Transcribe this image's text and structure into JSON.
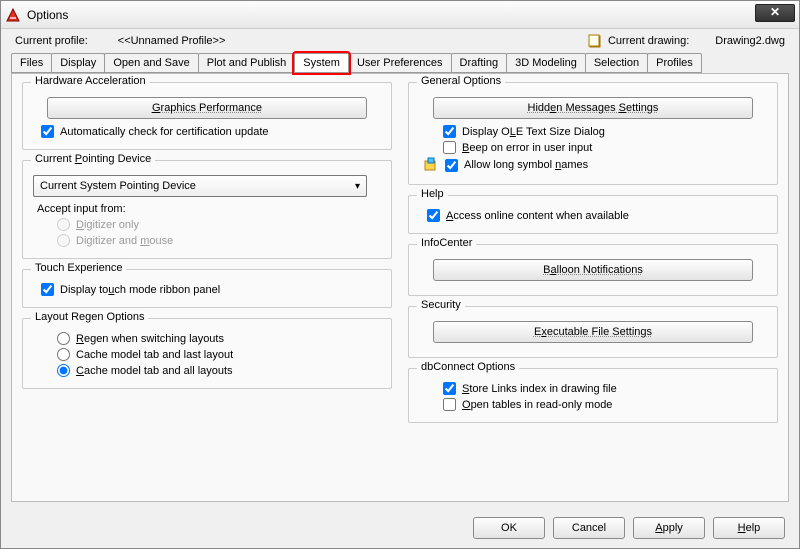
{
  "window": {
    "title": "Options"
  },
  "profile": {
    "label": "Current profile:",
    "value": "<<Unnamed Profile>>",
    "drawing_label": "Current drawing:",
    "drawing_value": "Drawing2.dwg"
  },
  "tabs": [
    {
      "label": "Files"
    },
    {
      "label": "Display"
    },
    {
      "label": "Open and Save"
    },
    {
      "label": "Plot and Publish"
    },
    {
      "label": "System",
      "active": true
    },
    {
      "label": "User Preferences"
    },
    {
      "label": "Drafting"
    },
    {
      "label": "3D Modeling"
    },
    {
      "label": "Selection"
    },
    {
      "label": "Profiles"
    }
  ],
  "left": {
    "hw_accel": {
      "title": "Hardware Acceleration",
      "button": "Graphics Performance",
      "auto_check": "Automatically check for certification update",
      "auto_check_val": true
    },
    "pointing": {
      "title": "Current Pointing Device",
      "combo": "Current System Pointing Device",
      "accept_label": "Accept input from:",
      "opt1": "Digitizer only",
      "opt2": "Digitizer and mouse",
      "enabled": false
    },
    "touch": {
      "title": "Touch Experience",
      "chk": "Display touch mode ribbon panel",
      "chk_val": true
    },
    "regen": {
      "title": "Layout Regen Options",
      "opt1": "Regen when switching layouts",
      "opt2": "Cache model tab and last layout",
      "opt3": "Cache model tab and all layouts",
      "selected": 3
    }
  },
  "right": {
    "general": {
      "title": "General Options",
      "button": "Hidden Messages Settings",
      "opt1": "Display OLE Text Size Dialog",
      "opt1_val": true,
      "opt2": "Beep on error in user input",
      "opt2_val": false,
      "opt3": "Allow long symbol names",
      "opt3_val": true
    },
    "help": {
      "title": "Help",
      "opt1": "Access online content when available",
      "opt1_val": true
    },
    "infocenter": {
      "title": "InfoCenter",
      "button": "Balloon Notifications"
    },
    "security": {
      "title": "Security",
      "button": "Executable File Settings"
    },
    "dbconnect": {
      "title": "dbConnect Options",
      "opt1": "Store Links index in drawing file",
      "opt1_val": true,
      "opt2": "Open tables in read-only mode",
      "opt2_val": false
    }
  },
  "footer": {
    "ok": "OK",
    "cancel": "Cancel",
    "apply": "Apply",
    "help": "Help"
  }
}
